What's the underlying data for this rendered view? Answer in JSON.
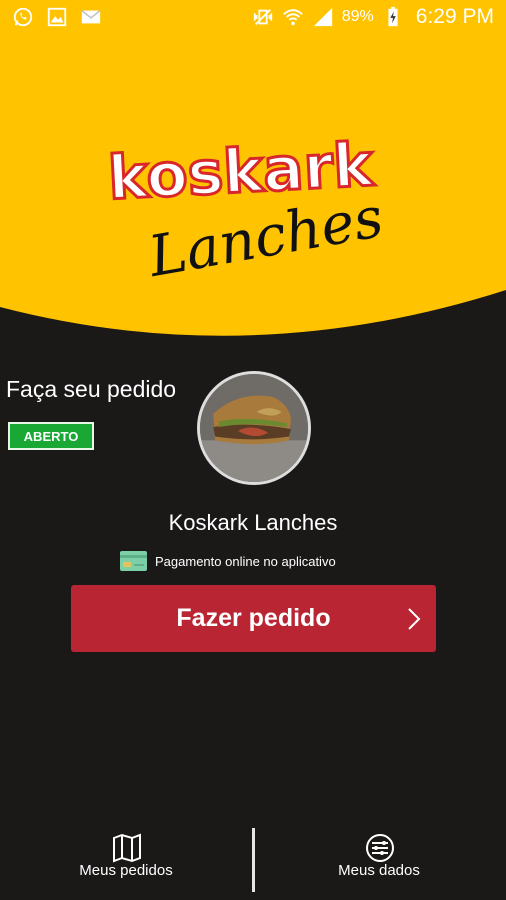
{
  "colors": {
    "background": "#1b1818",
    "hero_yellow": "#ffc300",
    "accent_red": "#b92532",
    "badge_green": "#1aa835"
  },
  "status_bar": {
    "left_icons": [
      "whatsapp-icon",
      "gallery-icon",
      "mail-icon"
    ],
    "right_icons": [
      "vibrate-icon",
      "wifi-icon",
      "signal-icon",
      "battery-charging-icon"
    ],
    "battery": "89%",
    "time": "6:29 PM"
  },
  "logo": {
    "line1": "koskark",
    "line2": "Lanches"
  },
  "restaurant": {
    "tagline": "Faça seu pedido",
    "status": "ABERTO",
    "name": "Koskark Lanches",
    "payment_text": "Pagamento online no aplicativo",
    "payment_icon": "credit-card-icon"
  },
  "actions": {
    "order_label": "Fazer pedido"
  },
  "bottom_nav": {
    "items": [
      {
        "label": "Meus pedidos",
        "icon": "map-icon"
      },
      {
        "label": "Meus dados",
        "icon": "sliders-icon"
      }
    ]
  }
}
